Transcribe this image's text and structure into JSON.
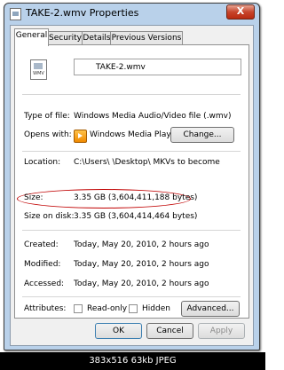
{
  "window": {
    "title": "TAKE-2.wmv Properties",
    "close_glyph": "X"
  },
  "tabs": [
    {
      "label": "General",
      "active": true
    },
    {
      "label": "Security",
      "active": false
    },
    {
      "label": "Details",
      "active": false
    },
    {
      "label": "Previous Versions",
      "active": false
    }
  ],
  "file": {
    "name": "TAKE-2.wmv",
    "icon_label": "WMV"
  },
  "properties": {
    "type_label": "Type of file:",
    "type_value": "Windows Media Audio/Video file (.wmv)",
    "opens_label": "Opens with:",
    "opens_value": "Windows Media Player",
    "change_button": "Change...",
    "location_label": "Location:",
    "location_value": "C:\\Users\\        \\Desktop\\        MKVs to become",
    "size_label": "Size:",
    "size_value": "3.35 GB (3,604,411,188 bytes)",
    "size_disk_label": "Size on disk:",
    "size_disk_value": "3.35 GB (3,604,414,464 bytes)",
    "created_label": "Created:",
    "created_value": "Today, May 20, 2010, 2 hours ago",
    "modified_label": "Modified:",
    "modified_value": "Today, May 20, 2010, 2 hours ago",
    "accessed_label": "Accessed:",
    "accessed_value": "Today, May 20, 2010, 2 hours ago",
    "attributes_label": "Attributes:",
    "readonly_label": "Read-only",
    "hidden_label": "Hidden",
    "advanced_button": "Advanced..."
  },
  "footer": {
    "ok": "OK",
    "cancel": "Cancel",
    "apply": "Apply"
  },
  "caption": "383x516  63kb  JPEG",
  "colors": {
    "highlight_ellipse": "#c00000",
    "frame": "#b9d1ea"
  }
}
